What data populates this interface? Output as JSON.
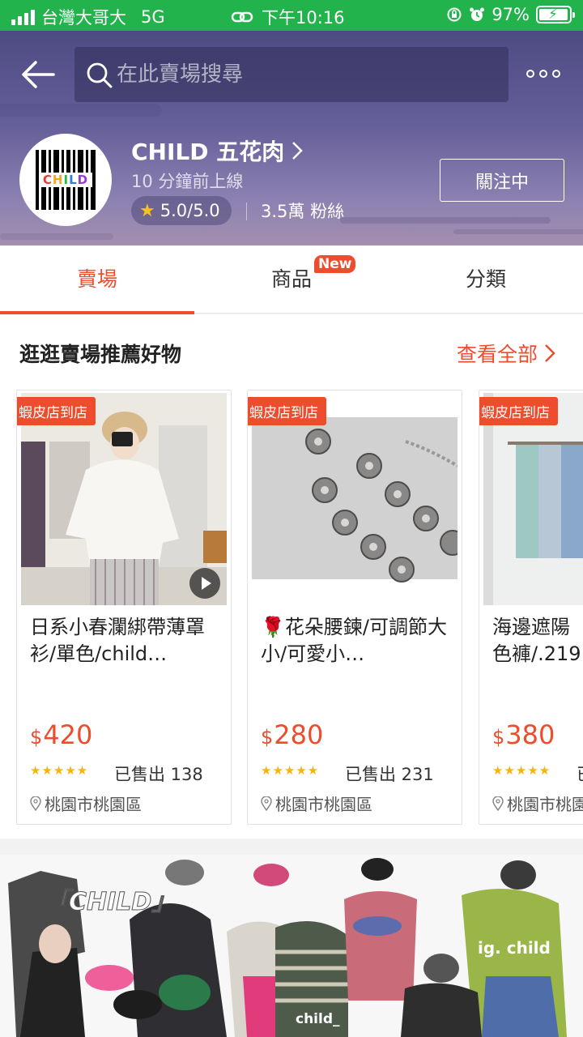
{
  "status_bar": {
    "carrier": "台灣大哥大",
    "network": "5G",
    "time": "下午10:16",
    "battery": "97%",
    "battery_level": 0.97
  },
  "header": {
    "search_placeholder": "在此賣場搜尋",
    "shop_name": "CHILD 五花肉",
    "avatar_text": "CHILD",
    "online_status": "10 分鐘前上線",
    "rating": "5.0/5.0",
    "followers": "3.5萬 粉絲",
    "follow_label": "關注中"
  },
  "tabs": [
    {
      "label": "賣場",
      "active": true
    },
    {
      "label": "商品",
      "active": false,
      "badge": "New"
    },
    {
      "label": "分類",
      "active": false
    }
  ],
  "recommend": {
    "title": "逛逛賣場推薦好物",
    "see_all": "查看全部",
    "products": [
      {
        "tag": "蝦皮店到店",
        "name": "日系小春瀾綁帶薄罩衫/單色/child…",
        "currency": "$",
        "price": "420",
        "sold": "已售出 138",
        "location": "桃園市桃園區",
        "has_video": true
      },
      {
        "tag": "蝦皮店到店",
        "name": "🌹花朵腰鍊/可調節大小/可愛小…",
        "currency": "$",
        "price": "280",
        "sold": "已售出 231",
        "location": "桃園市桃園區",
        "has_video": false
      },
      {
        "tag": "蝦皮店到店",
        "name": "海邊遮陽色褲/.219",
        "currency": "$",
        "price": "380",
        "sold": "已售出",
        "location": "桃園市桃園區",
        "has_video": false
      }
    ]
  },
  "banner": {
    "brand": "「CHILD」",
    "ig": "ig. child",
    "watermark": "child_"
  },
  "colors": {
    "accent": "#ee4d2d",
    "status_bar": "#22b34c",
    "star": "#f6b40e"
  }
}
